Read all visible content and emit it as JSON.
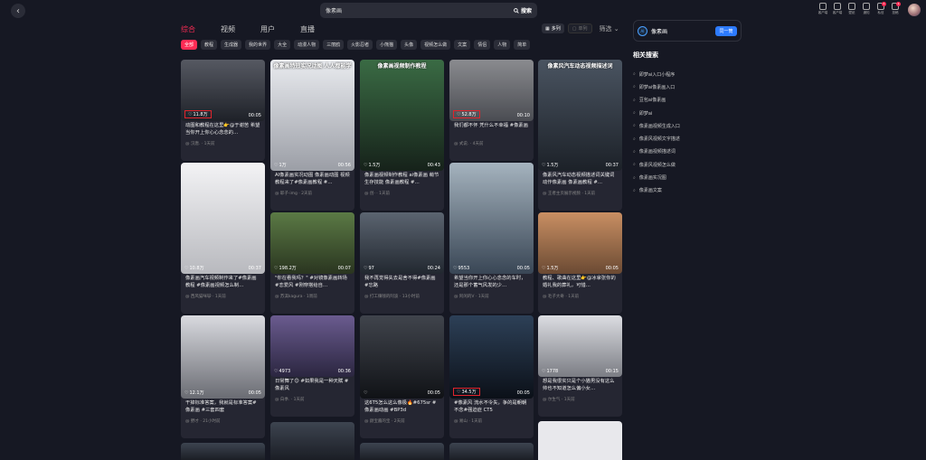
{
  "header": {
    "back_icon": "back-arrow",
    "search_value": "像素画",
    "search_button": "搜索",
    "top_icons": [
      {
        "label": "客户端",
        "badge": ""
      },
      {
        "label": "客户端",
        "badge": ""
      },
      {
        "label": "壁纸",
        "badge": ""
      },
      {
        "label": "通知",
        "badge": ""
      },
      {
        "label": "私信",
        "badge": "1"
      },
      {
        "label": "投稿",
        "badge": "1"
      }
    ]
  },
  "tabs": [
    "综合",
    "视频",
    "用户",
    "直播"
  ],
  "view": {
    "grid": "多列",
    "single": "单列",
    "filter": "筛选"
  },
  "chips": [
    "全部",
    "教程",
    "生成器",
    "我的世界",
    "大全",
    "动漫人物",
    "三丽鸥",
    "火影忍者",
    "小熊猫",
    "头像",
    "视频怎么做",
    "文案",
    "情侣",
    "人物",
    "简单"
  ],
  "results": [
    {
      "title": "",
      "likes": "11.8万",
      "dur": "00:05",
      "desc": "动图和教程在这里👉@于谢苦 希望当你开上你心心念念的…",
      "author": "@ 汉唐.",
      "time": "1天前"
    },
    {
      "title": "像素画特效实况动图 人人都能学",
      "likes": "1万",
      "dur": "00:56",
      "desc": "AI像素画实况动图 像素画动图 视频教程来了#像素画教程 #…",
      "author": "@ 耶子·img",
      "time": "2天前"
    },
    {
      "title": "像素画视频制作教程",
      "likes": "1.5万",
      "dur": "00:43",
      "desc": "像素画视频制作教程 ai像素画 萌节生存技能 像素画教程 #…",
      "author": "@ 创·",
      "time": "1天前"
    },
    {
      "title": "",
      "likes": "52.8万",
      "dur": "00:10",
      "desc": "我们都不怀 凭什么不幸福 #像素画",
      "author": "@ 式说.",
      "time": "4天前"
    },
    {
      "title": "像素风汽车动态视频描述词",
      "likes": "1.5万",
      "dur": "00:37",
      "desc": "像素风汽车动态视频描述词关键词动作像素画 像素画教程 #…",
      "author": "@ 王者主页展示视频",
      "time": "1天前"
    },
    {
      "title": "",
      "likes": "10.8万",
      "dur": "00:37",
      "desc": "像素画汽车视频制作来了#像素画教程 #像素画视频怎么制…",
      "author": "@ 西风猫咪😺",
      "time": "1天前"
    },
    {
      "title": "",
      "likes": "198.2万",
      "dur": "00:07",
      "desc": "\"你在看我吗？\" #对镜像素画转场 #恋爱风 #刚穿搭给自…",
      "author": "@ 苏淇kagura",
      "time": "1周前"
    },
    {
      "title": "",
      "likes": "97",
      "dur": "00:24",
      "desc": "我不再觉得失去是舍不得#像素画 #忘路",
      "author": "@ 打工赚钱的阿波",
      "time": "13小时前"
    },
    {
      "title": "",
      "likes": "9553",
      "dur": "00:05",
      "desc": "希望当你开上你心心念念的车时，还是那个蓄气风发的少…",
      "author": "@ 阿闲的V",
      "time": "1天前"
    },
    {
      "title": "",
      "likes": "1.5万",
      "dur": "00:05",
      "desc": "教程、歌曲在这里👉@冰拿张你的婚礼我的葬礼，可惜…",
      "author": "@ 毛子大奇",
      "time": "1天前"
    },
    {
      "title": "",
      "likes": "12.1万",
      "dur": "00:05",
      "desc": "干掉标准答案，我就是标准答案#像素画 #三套四套",
      "author": "@ 野才",
      "time": "21小时前"
    },
    {
      "title": "",
      "likes": "4973",
      "dur": "00:36",
      "desc": "日常舞了😊 #如果我是一种天赋 #像素风",
      "author": "@ 白季.",
      "time": "1天前"
    },
    {
      "title": "",
      "likes": "",
      "dur": "00:05",
      "desc": "这6T5怎么这么像极🔥#675sr #像素画动画 #BP3d",
      "author": "@ 颜宝酱的宝",
      "time": "2天前"
    },
    {
      "title": "",
      "likes": "34.5万",
      "dur": "00:05",
      "desc": "#像素风 流水不令失，争的是朝朝不念#强迫症 CT5",
      "author": "@ 易山",
      "time": "1天前"
    },
    {
      "title": "",
      "likes": "1778",
      "dur": "00:15",
      "desc": "想是我很实只是个小猫男没有这么帅也不知道怎么偏小女…",
      "author": "@ 尔生气",
      "time": "1天前"
    }
  ],
  "sidebar": {
    "app_name": "像素画",
    "app_logo": "AI",
    "open_button": "同一筒",
    "related_title": "相关搜索",
    "related": [
      "即梦ai入口小程序",
      "即梦ai像素画入口",
      "豆包ai像素画",
      "即梦ai",
      "像素画视频生成入口",
      "像素风视频文字描述",
      "像素画视频描述词",
      "像素风视频怎么做",
      "像素画实况图",
      "像素画文案"
    ]
  }
}
